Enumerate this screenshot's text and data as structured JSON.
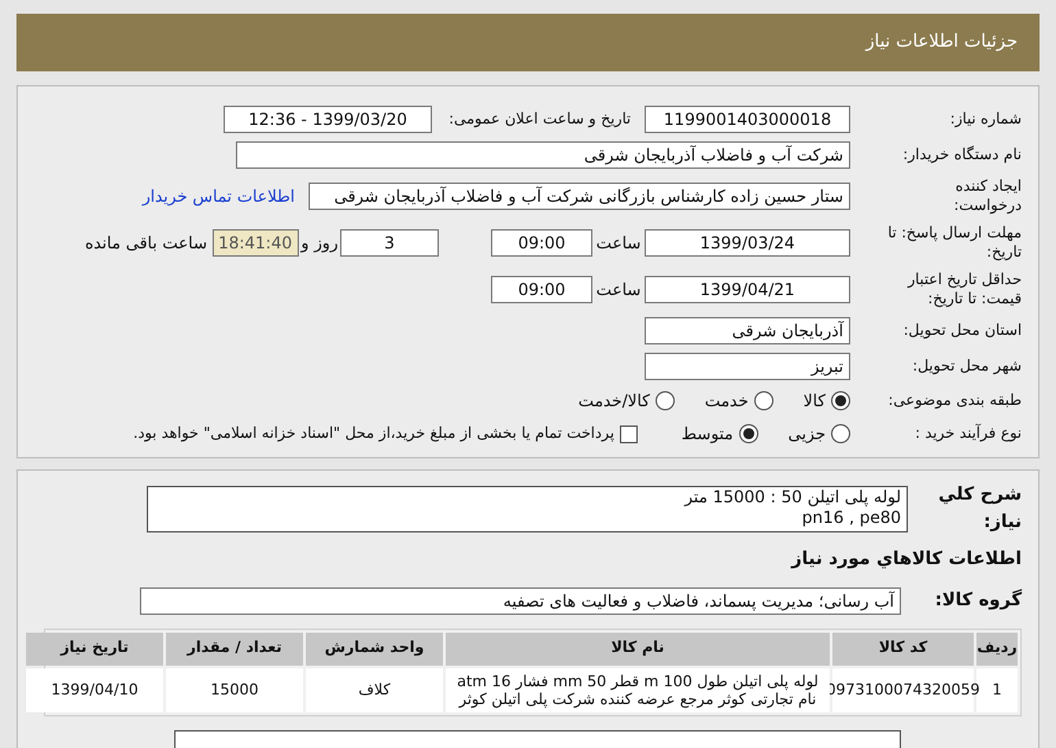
{
  "header": {
    "title": "جزئیات اطلاعات نیاز"
  },
  "fields": {
    "need_number": {
      "label": "شماره نیاز:",
      "value": "1199001403000018"
    },
    "announce": {
      "label": "تاریخ و ساعت اعلان عمومی:",
      "value": "1399/03/20 - 12:36"
    },
    "buyer": {
      "label": "نام دستگاه خریدار:",
      "value": "شرکت آب و فاضلاب آذربایجان شرقی"
    },
    "creator": {
      "label": "ایجاد کننده درخواست:",
      "value": "ستار حسین زاده کارشناس بازرگانی شرکت آب و فاضلاب آذربایجان شرقی",
      "link": "اطلاعات تماس خریدار"
    },
    "deadline": {
      "label": "مهلت ارسال پاسخ: تا تاریخ:",
      "date": "1399/03/24",
      "time_label": "ساعت",
      "time": "09:00",
      "days": "3",
      "days_label": "روز و",
      "remaining": "18:41:40",
      "remaining_label": "ساعت باقی مانده"
    },
    "validity": {
      "label": "حداقل تاریخ اعتبار قیمت: تا تاریخ:",
      "date": "1399/04/21",
      "time_label": "ساعت",
      "time": "09:00"
    },
    "province": {
      "label": "استان محل تحویل:",
      "value": "آذربایجان شرقی"
    },
    "city": {
      "label": "شهر محل تحویل:",
      "value": "تبریز"
    }
  },
  "category": {
    "label": "طبقه بندی موضوعی:",
    "options": [
      {
        "label": "کالا",
        "selected": true
      },
      {
        "label": "خدمت",
        "selected": false
      },
      {
        "label": "کالا/خدمت",
        "selected": false
      }
    ]
  },
  "process": {
    "label": "نوع فرآیند خرید :",
    "options": [
      {
        "label": "جزیی",
        "selected": false
      },
      {
        "label": "متوسط",
        "selected": true
      }
    ],
    "treasury": {
      "label": "پرداخت تمام یا بخشی از مبلغ خرید،از محل \"اسناد خزانه اسلامی\" خواهد بود.",
      "checked": false
    }
  },
  "description": {
    "label": "شرح كلي نياز:",
    "lines": [
      "لوله پلی اتیلن 50 : 15000 متر",
      "pn16 , pe80"
    ]
  },
  "goods_heading": "اطلاعات كالاهاي مورد نياز",
  "goods_group": {
    "label": "گروه کالا:",
    "value": "آب رسانی؛ مدیریت پسماند، فاضلاب و فعالیت های تصفیه"
  },
  "table": {
    "columns": [
      "ردیف",
      "کد کالا",
      "نام کالا",
      "واحد شمارش",
      "تعداد / مقدار",
      "تاریخ نیاز"
    ],
    "rows": [
      [
        "1",
        "0973100074320059",
        "لوله پلی اتیلن طول 100 m قطر 50 mm فشار 16 atm نام تجارتی کوثر مرجع عرضه کننده شرکت پلی اتیلن کوثر",
        "کلاف",
        "15000",
        "1399/04/10"
      ]
    ]
  }
}
